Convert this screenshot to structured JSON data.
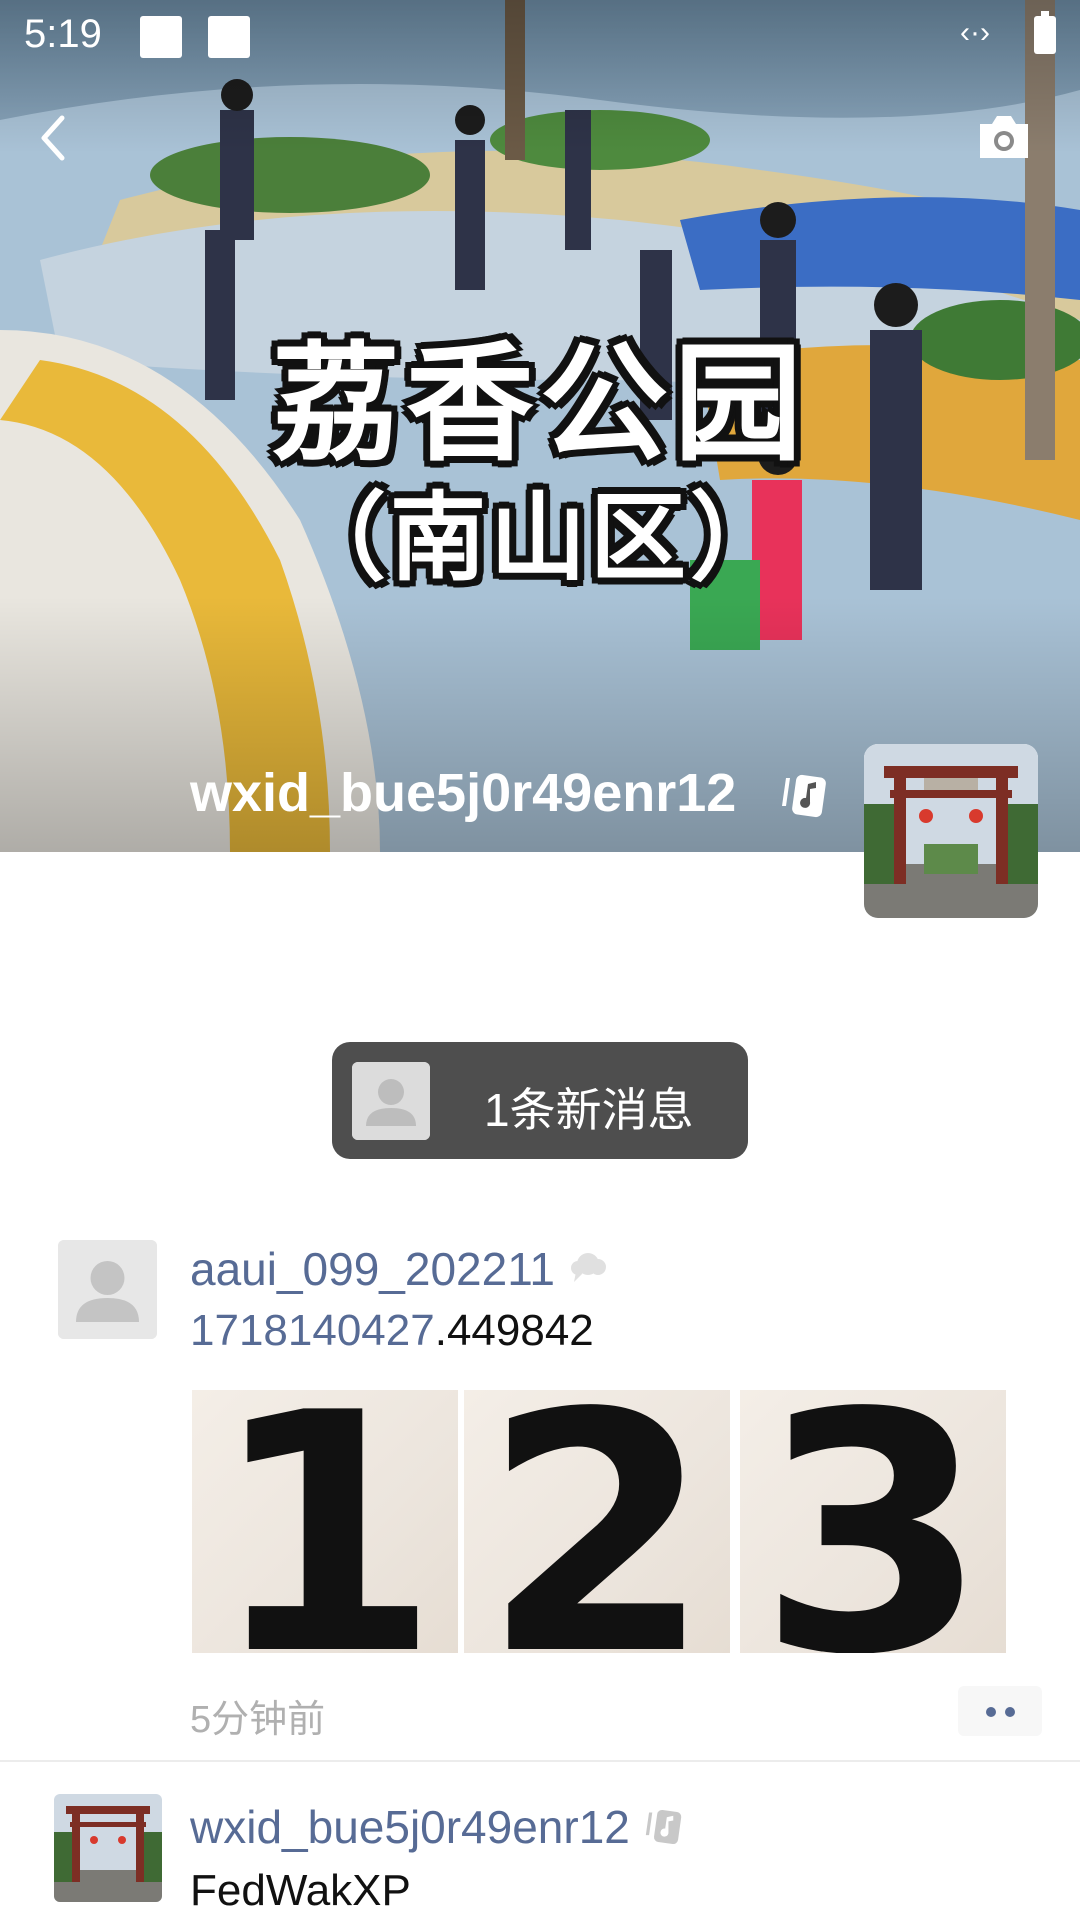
{
  "status_bar": {
    "time": "5:19",
    "network_icon": "arrows-icon",
    "battery_icon": "battery-icon"
  },
  "cover": {
    "title_line1": "荔香公园",
    "title_line2": "（南山区）",
    "photo": "park-playground-photo"
  },
  "header": {
    "back_icon": "back-arrow-icon",
    "camera_icon": "camera-icon"
  },
  "profile": {
    "nickname": "wxid_bue5j0r49enr12",
    "badge_icon": "music-note-icon",
    "avatar": "archway-photo"
  },
  "new_message": {
    "label": "1条新消息"
  },
  "posts": [
    {
      "username": "aaui_099_202211",
      "badge_icon": "cloud-icon",
      "text_link": "1718140427",
      "text_rest": ".449842",
      "images": [
        "1",
        "2",
        "3"
      ],
      "time": "5分钟前",
      "more_icon": "more-dots-icon"
    },
    {
      "username": "wxid_bue5j0r49enr12",
      "badge_icon": "music-note-icon",
      "text": "FedWakXP"
    }
  ],
  "colors": {
    "link": "#576b95",
    "pill_bg": "#4e4e4e",
    "time_gray": "#b0b0b0"
  }
}
